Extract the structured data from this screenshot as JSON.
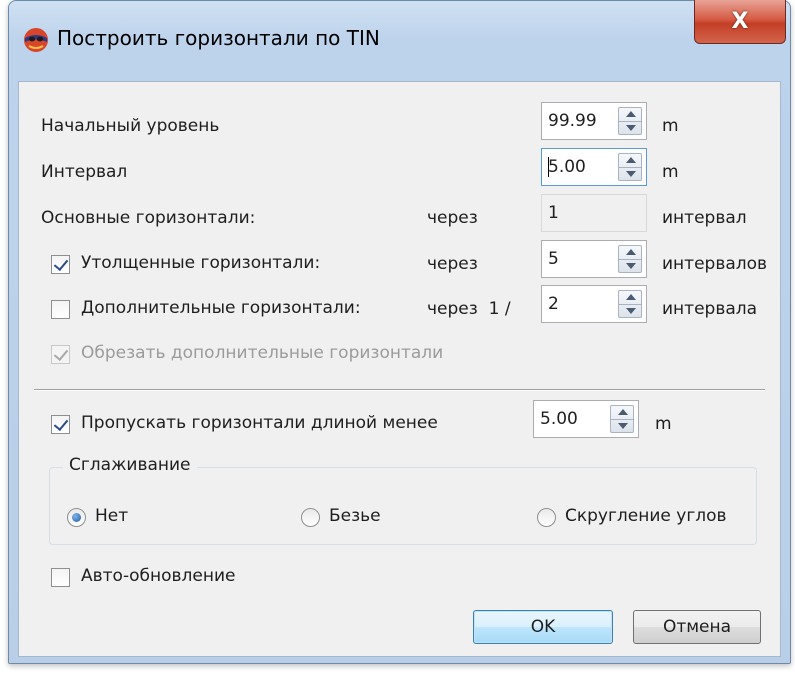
{
  "window": {
    "title": "Построить горизонтали по TIN",
    "close_label": "X",
    "app_icon": "globe-icon"
  },
  "form": {
    "start_level": {
      "label": "Начальный уровень",
      "value": "99.99",
      "unit": "m"
    },
    "interval": {
      "label": "Интервал",
      "value": "5.00",
      "unit": "m"
    },
    "main_contours": {
      "label": "Основные горизонтали:",
      "through": "через",
      "value": "1",
      "unit": "интервал"
    },
    "thick_contours": {
      "label": "Утолщенные горизонтали:",
      "checked": true,
      "through": "через",
      "value": "5",
      "unit": "интервалов"
    },
    "extra_contours": {
      "label": "Дополнительные горизонтали:",
      "checked": false,
      "through": "через  1 /",
      "value": "2",
      "unit": "интервала"
    },
    "trim_extra": {
      "label": "Обрезать дополнительные горизонтали",
      "checked": true,
      "disabled": true
    },
    "skip_short": {
      "label": "Пропускать горизонтали длиной менее",
      "checked": true,
      "value": "5.00",
      "unit": "m"
    },
    "smoothing": {
      "title": "Сглаживание",
      "options": [
        {
          "label": "Нет",
          "selected": true
        },
        {
          "label": "Безье",
          "selected": false
        },
        {
          "label": "Скругление углов",
          "selected": false
        }
      ]
    },
    "auto_update": {
      "label": "Авто-обновление",
      "checked": false
    }
  },
  "buttons": {
    "ok": "OK",
    "cancel": "Отмена"
  }
}
